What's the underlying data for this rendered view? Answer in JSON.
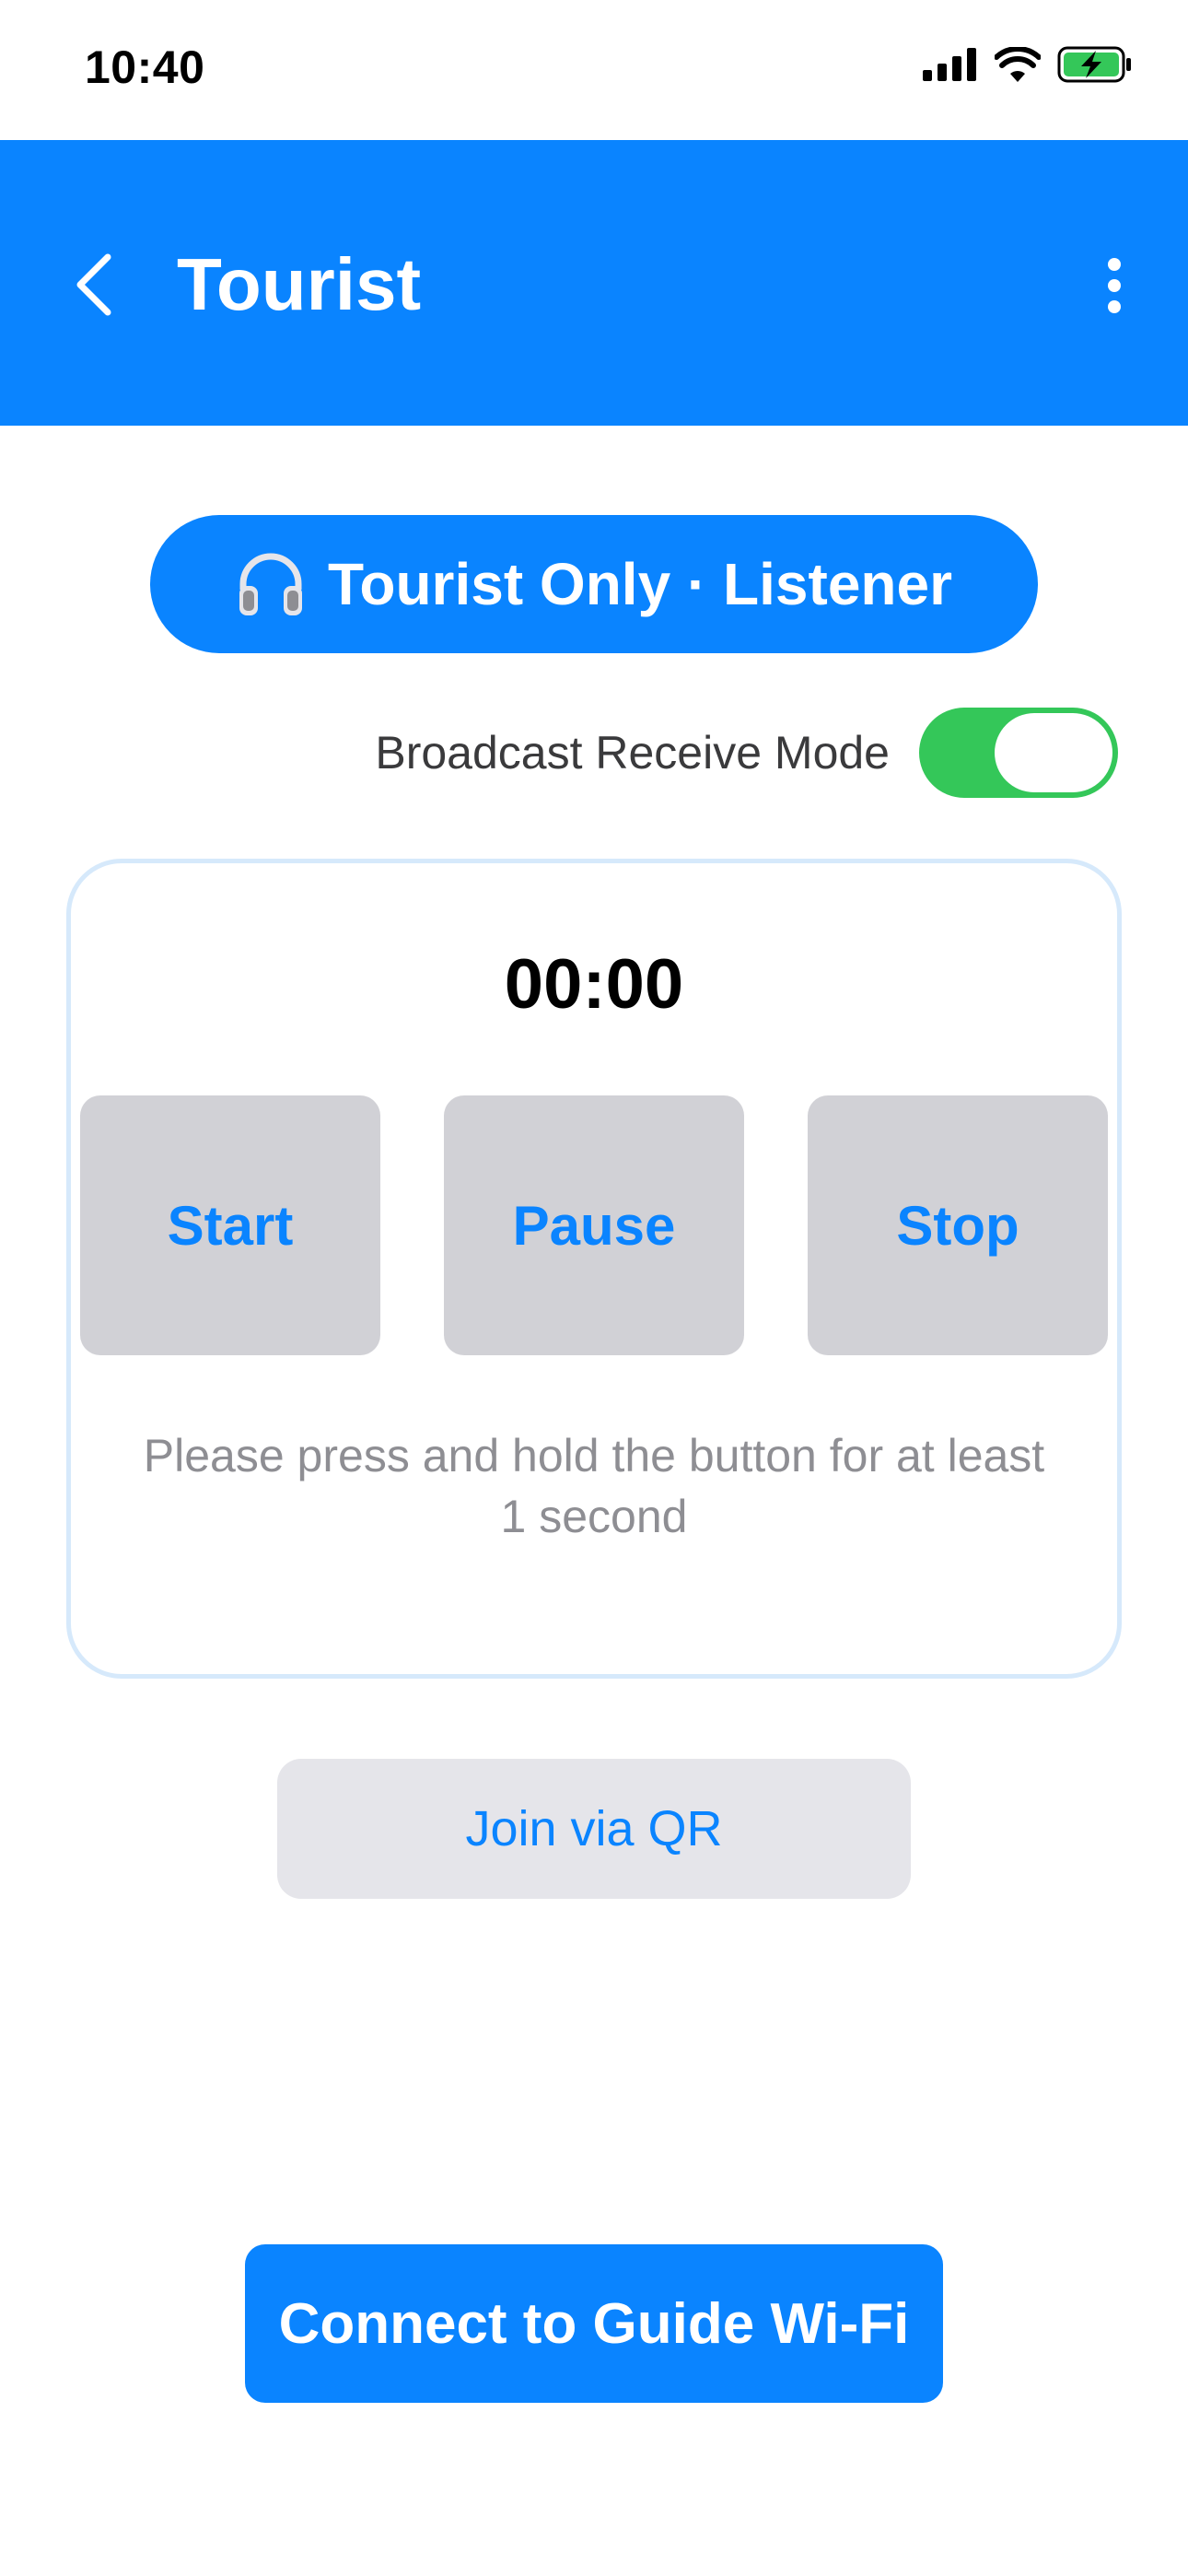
{
  "status_bar": {
    "time": "10:40",
    "icons": [
      "signal-icon",
      "wifi-icon",
      "battery-charging-icon"
    ]
  },
  "app_bar": {
    "title": "Tourist",
    "back_icon": "chevron-left-icon",
    "more_icon": "more-vertical-icon",
    "background": "#0A84FF"
  },
  "role_badge": {
    "icon": "headphones-icon",
    "label": "Tourist Only · Listener"
  },
  "broadcast_toggle": {
    "label": "Broadcast Receive Mode",
    "on": true,
    "color": "#34C759"
  },
  "recorder": {
    "timer": "00:00",
    "start_label": "Start",
    "pause_label": "Pause",
    "stop_label": "Stop",
    "hint": "Please press and hold the button for at least 1 second"
  },
  "join_qr_label": "Join via QR",
  "connect_wifi_label": "Connect to Guide Wi-Fi",
  "colors": {
    "accent": "#0A84FF",
    "button_gray": "#D1D1D6",
    "secondary_button": "#E5E5EA",
    "card_border": "#D6E9FB"
  }
}
